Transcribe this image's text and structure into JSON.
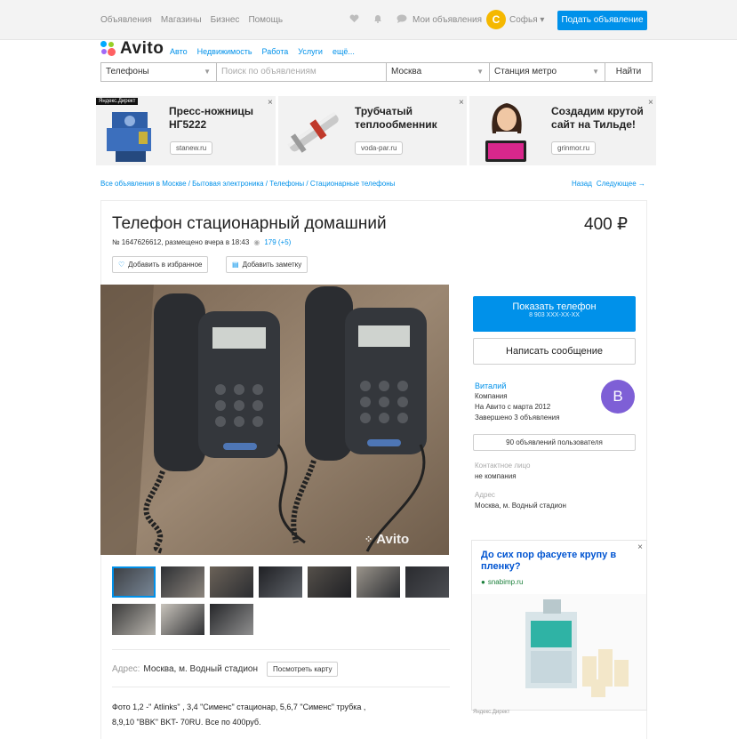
{
  "header": {
    "nav": [
      "Объявления",
      "Магазины",
      "Бизнес",
      "Помощь"
    ],
    "my_ads": "Мои объявления",
    "user_initial": "С",
    "user_name": "Софья",
    "post_button": "Подать объявление",
    "accent": "#0091ea"
  },
  "logo": {
    "text": "Avito"
  },
  "categories": [
    "Авто",
    "Недвижимость",
    "Работа",
    "Услуги",
    "ещё..."
  ],
  "search": {
    "category": "Телефоны",
    "placeholder": "Поиск по объявлениям",
    "city": "Москва",
    "metro": "Станция метро",
    "submit": "Найти"
  },
  "ads": [
    {
      "title_1": "Пресс-ножницы",
      "title_2": "НГ5222",
      "domain": "stanew.ru",
      "tag": "Яндекс.Директ"
    },
    {
      "title_1": "Трубчатый",
      "title_2": "теплообменник",
      "domain": "voda-par.ru"
    },
    {
      "title_1": "Создадим крутой",
      "title_2": "сайт на Тильде!",
      "domain": "grinmor.ru"
    }
  ],
  "breadcrumb": "Все объявления в Москве / Бытовая электроника / Телефоны / Стационарные телефоны",
  "nav_back": "Назад",
  "nav_next": "Следующее →",
  "listing": {
    "title": "Телефон стационарный домашний",
    "price": "400 ₽",
    "meta": "№ 1647626612, размещено вчера в 18:43",
    "views": "179 (+5)",
    "favorite": "Добавить в избранное",
    "note": "Добавить заметку",
    "watermark": "Avito",
    "address_label": "Адрес:",
    "address": "Москва, м. Водный стадион",
    "map_button": "Посмотреть карту",
    "description_1": "Фото 1,2 -\" Atlinks\" , 3,4 \"Сименс\" стационар, 5,6,7 \"Сименс\" трубка ,",
    "description_2": "8,9,10 \"BBK\" BKT- 70RU. Все по 400руб."
  },
  "contact": {
    "show_phone": "Показать телефон",
    "phone_mask": "8 903 XXX-XX-XX",
    "write": "Написать сообщение",
    "seller_name": "Виталий",
    "seller_type": "Компания",
    "seller_since": "На Авито с марта 2012",
    "seller_done": "Завершено 3 объявления",
    "seller_initial": "В",
    "all_ads": "90 объявлений пользователя",
    "contact_label": "Контактное лицо",
    "contact_value": "не компания",
    "addr_label": "Адрес",
    "addr_value": "Москва, м. Водный стадион"
  },
  "side_ad": {
    "headline": "До сих пор фасуете крупу в пленку?",
    "domain": "snabimp.ru",
    "footer": "Яндекс.Директ"
  }
}
